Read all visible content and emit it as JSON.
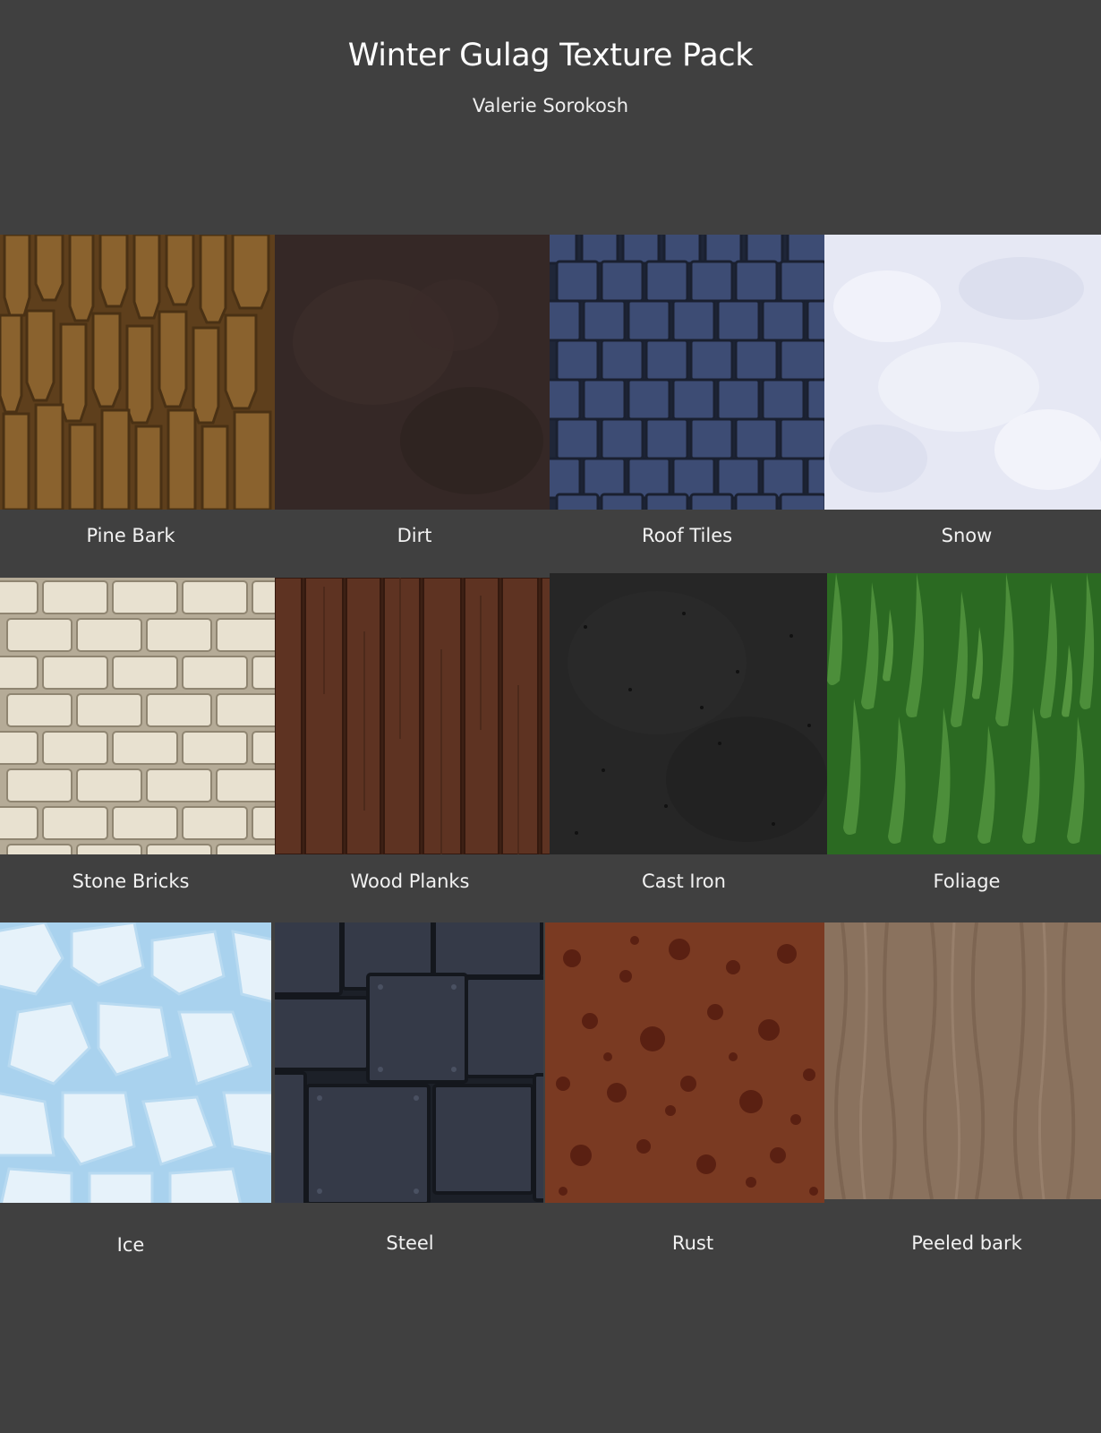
{
  "header": {
    "title": "Winter Gulag Texture Pack",
    "author": "Valerie Sorokosh"
  },
  "textures": [
    {
      "label": "Pine Bark"
    },
    {
      "label": "Dirt"
    },
    {
      "label": "Roof Tiles"
    },
    {
      "label": "Snow"
    },
    {
      "label": "Stone Bricks"
    },
    {
      "label": "Wood Planks"
    },
    {
      "label": "Cast Iron"
    },
    {
      "label": "Foliage"
    },
    {
      "label": "Ice"
    },
    {
      "label": "Steel"
    },
    {
      "label": "Rust"
    },
    {
      "label": "Peeled bark"
    }
  ],
  "colors": {
    "background": "#404040",
    "pine_bark": "#7a5628",
    "dirt": "#352826",
    "roof_tiles": "#3a4a72",
    "snow": "#e6e8f4",
    "stone_bricks": "#e3dccb",
    "wood_planks": "#5a3020",
    "cast_iron": "#262626",
    "foliage": "#3c7a2e",
    "ice": "#d4e8f5",
    "steel": "#333844",
    "rust": "#7a3a22",
    "peeled_bark": "#8a725e"
  }
}
